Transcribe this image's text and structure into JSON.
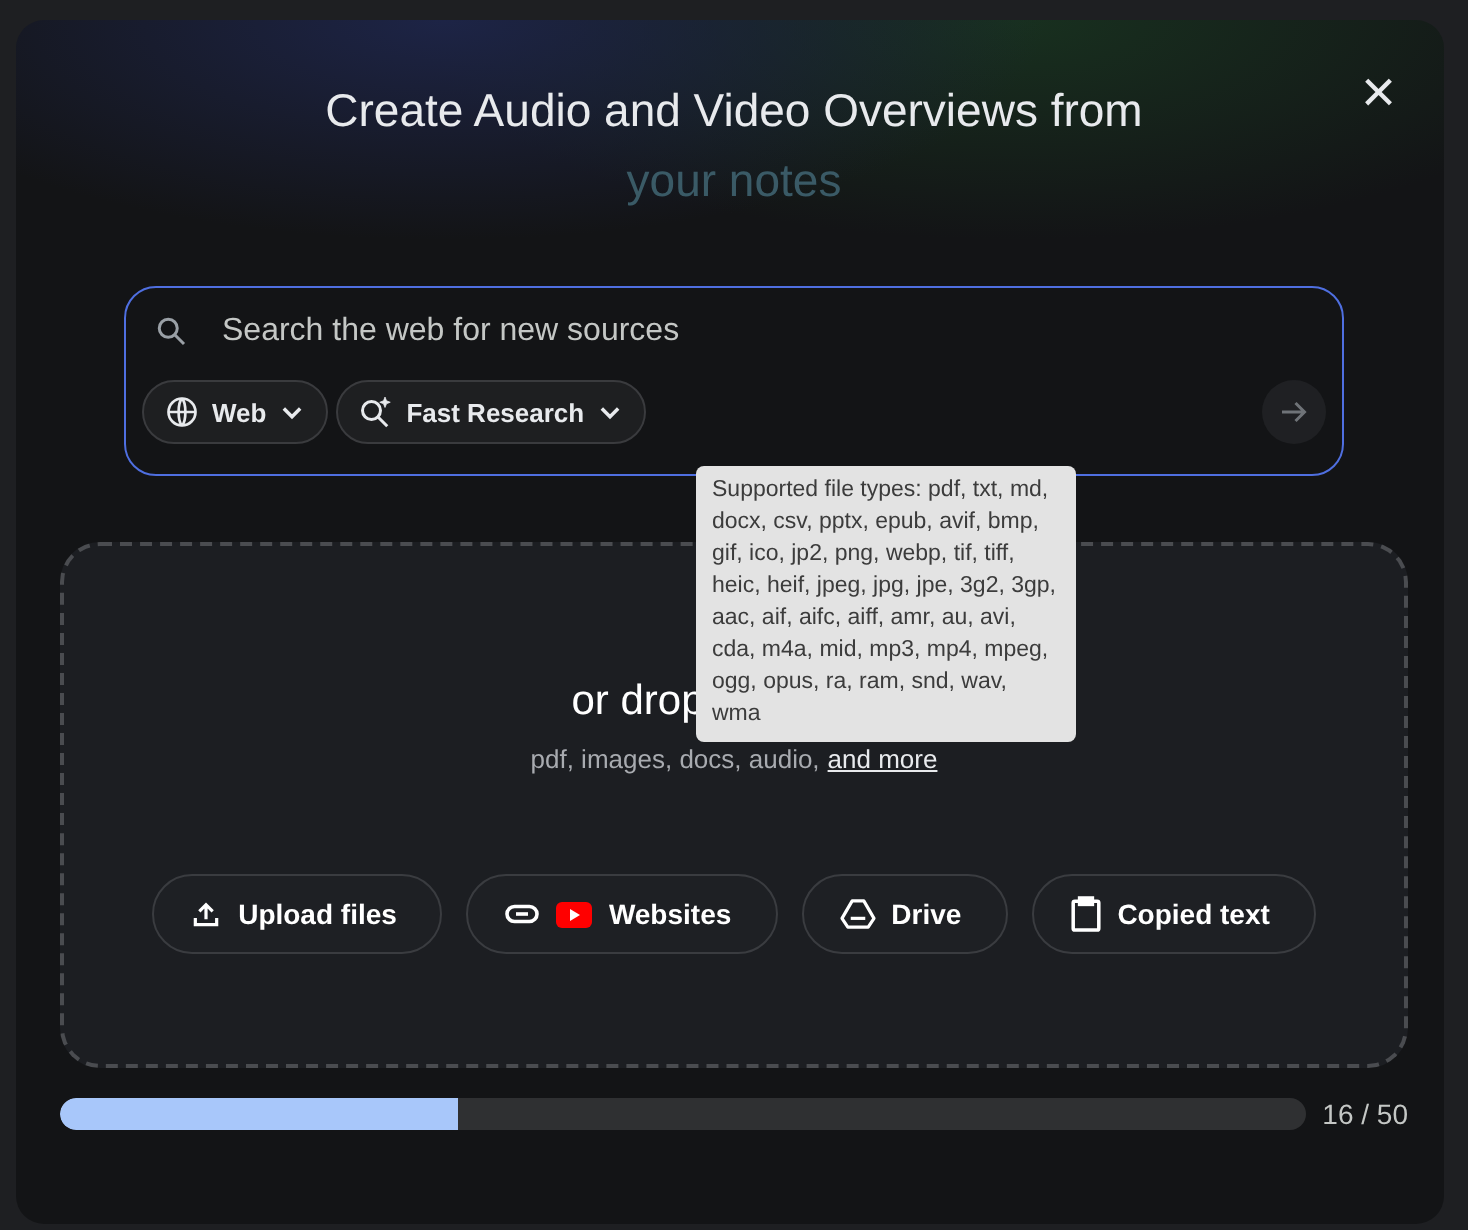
{
  "dialog": {
    "title": "Create Audio and Video Overviews from",
    "subtitle": "your notes",
    "close": "×"
  },
  "search": {
    "placeholder": "Search the web for new sources",
    "chips": [
      {
        "kind": "web",
        "label": "Web"
      },
      {
        "kind": "research",
        "label": "Fast Research"
      }
    ]
  },
  "tooltip": "Supported file types: pdf, txt, md, docx, csv, pptx, epub, avif, bmp, gif, ico, jp2, png, webp, tif, tiff, heic, heif, jpeg, jpg, jpe, 3g2, 3gp, aac, aif, aifc, aiff, amr, au, avi, cda, m4a, mid, mp3, mp4, mpeg, ogg, opus, ra, ram, snd, wav, wma",
  "dropzone": {
    "heading": "or drop",
    "hint": "pdf, images, docs, audio,",
    "link": "and more",
    "buttons": [
      {
        "kind": "upload",
        "label": "Upload files"
      },
      {
        "kind": "websites",
        "label": "Websites"
      },
      {
        "kind": "drive",
        "label": "Drive"
      },
      {
        "kind": "copied",
        "label": "Copied text"
      }
    ]
  },
  "limit": {
    "level": 0.32,
    "reading": "16 / 50"
  }
}
